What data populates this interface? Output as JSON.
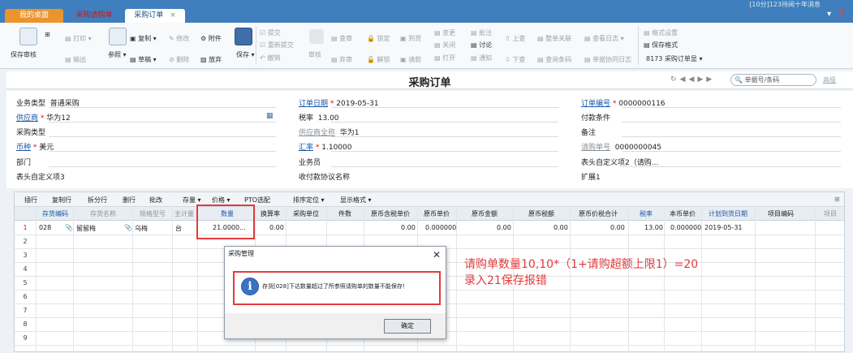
{
  "tabs": {
    "home": "我的桌面",
    "requisition": "采购请购单",
    "order": "采购订单"
  },
  "topbar_right": "[10分]123待阅十年消息",
  "toolbar": {
    "save_audit": "保存审核",
    "print": "打印",
    "output": "输出",
    "reference": "参照",
    "copy": "复制",
    "modify": "修改",
    "attachment": "附件",
    "draft": "草稿",
    "delete": "删除",
    "abandon": "放弃",
    "save": "保存",
    "submit": "提交",
    "resubmit": "重新提交",
    "withdraw": "撤销",
    "audit": "审核",
    "query": "查审",
    "abandon_audit": "弃审",
    "lock": "锁定",
    "unlock": "解锁",
    "arrival": "到货",
    "request_payment": "请款",
    "change": "变更",
    "close": "关闭",
    "open": "打开",
    "annotate": "批注",
    "discuss": "讨论",
    "notify": "通知",
    "prev": "上查",
    "next": "下查",
    "whole_link": "整单关联",
    "query_barcode": "查询条码",
    "view_log": "查看日志",
    "doc_collab_log": "单据协同日志",
    "format_setting": "格式设置",
    "save_format": "保存格式",
    "template": "8173 采购订单显"
  },
  "page_title": "采购订单",
  "search_placeholder": "单据号/条码",
  "advanced": "高级",
  "header_fields": {
    "biz_type_label": "业务类型",
    "biz_type": "普通采购",
    "order_date_label": "订单日期",
    "order_date": "2019-05-31",
    "order_no_label": "订单编号",
    "order_no": "0000000116",
    "supplier_label": "供应商",
    "supplier": "华为12",
    "tax_rate_label": "税率",
    "tax_rate": "13.00",
    "pay_terms_label": "付款条件",
    "purchase_type_label": "采购类型",
    "supplier_full_label": "供应商全称",
    "supplier_full": "华为1",
    "remark_label": "备注",
    "currency_label": "币种",
    "currency": "美元",
    "exchange_label": "汇率",
    "exchange": "1.10000",
    "req_no_label": "请购单号",
    "req_no": "0000000045",
    "dept_label": "部门",
    "salesman_label": "业务员",
    "custom2_label": "表头自定义项2（请购...",
    "custom3_label": "表头自定义项3",
    "agreement_label": "收付款协议名称",
    "ext1_label": "扩展1"
  },
  "grid_toolbar": [
    "插行",
    "复制行",
    "拆分行",
    "删行",
    "批改",
    "存量",
    "价格",
    "PTO选配",
    "排序定位",
    "显示格式"
  ],
  "columns": [
    "存货编码",
    "存货名称",
    "规格型号",
    "主计量",
    "数量",
    "换算率",
    "采购单位",
    "件数",
    "原币含税单价",
    "原币单价",
    "原币金额",
    "原币税额",
    "原币价税合计",
    "税率",
    "本币单价",
    "计划到货日期",
    "项目编码",
    "项目"
  ],
  "row1": {
    "no": "1",
    "code": "028",
    "name": "留留梅",
    "spec": "乌梅",
    "unit": "台",
    "qty": "21.0000...",
    "rate": "0.00",
    "tax_price": "0.00",
    "price": "0.000000",
    "amount": "0.00",
    "tax": "0.00",
    "total": "0.00",
    "tax_rate": "13.00",
    "local_price": "0.000000",
    "plan_date": "2019-05-31"
  },
  "row_numbers": [
    "2",
    "3",
    "4",
    "5",
    "6",
    "7",
    "8",
    "9"
  ],
  "dialog": {
    "title": "采购管理",
    "message": "存货[028]下达数量超过了所参照请购单的数量不能保存！",
    "ok": "确定"
  },
  "annotation": {
    "line1": "请购单数量10,10*（1+请购超额上限1）=20",
    "line2": "录入21保存报错"
  },
  "colors": {
    "topbar": "#3f7fbd",
    "accent_tab": "#e9942d",
    "annotation": "#e43a3a"
  }
}
